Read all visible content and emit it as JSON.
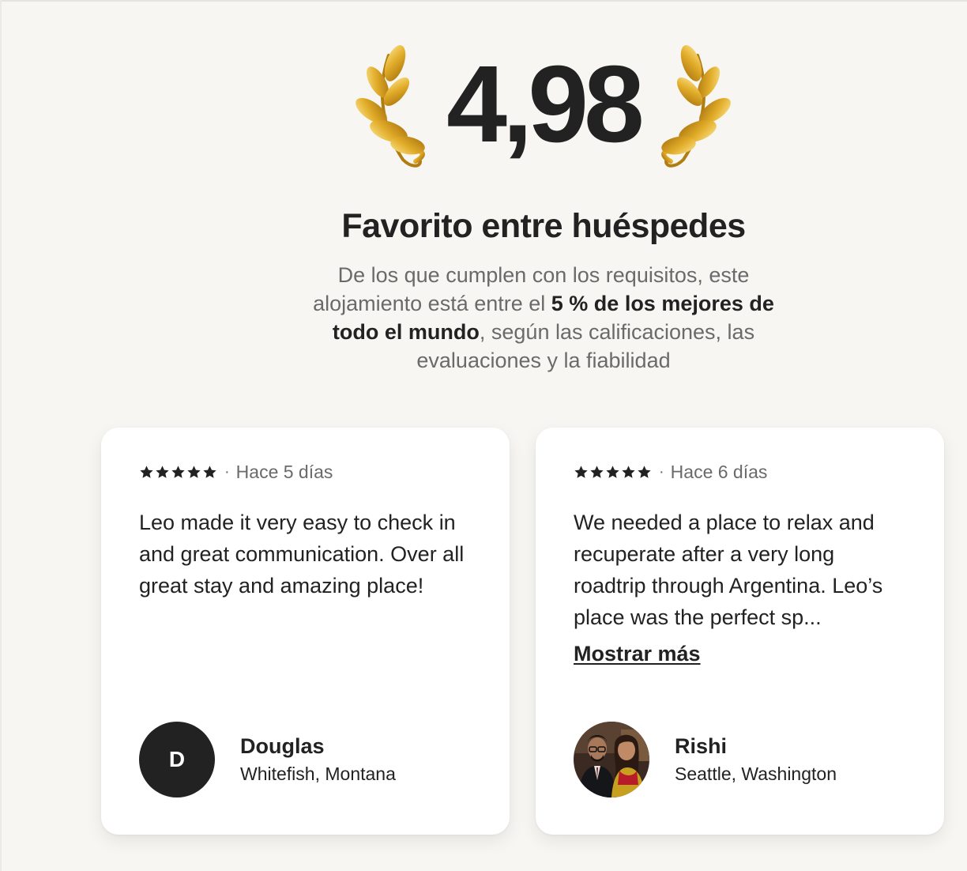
{
  "rating": {
    "value": "4,98",
    "icons": {
      "left": "laurel-left-icon",
      "right": "laurel-right-icon"
    },
    "laurel_color": "#d4a017"
  },
  "badge": {
    "title": "Favorito entre huéspedes",
    "description": {
      "part1": "De los que cumplen con los requisitos, este alojamiento está entre el ",
      "bold": "5 % de los mejores de todo el mundo",
      "part2": ", según las calificaciones, las evaluaciones y la fiabilidad"
    }
  },
  "reviews": [
    {
      "stars": 5,
      "star_icon": "star-icon",
      "separator": "·",
      "date": "Hace 5 días",
      "text": "Leo made it very easy to check in and great communication. Over all great stay and amazing place!",
      "author": {
        "initial": "D",
        "name": "Douglas",
        "location": "Whitefish, Montana"
      }
    },
    {
      "stars": 5,
      "star_icon": "star-icon",
      "separator": "·",
      "date": "Hace 6 días",
      "text": "We needed a place to relax and recuperate after a very long roadtrip through Argentina. Leo’s place was the perfect sp...",
      "show_more": "Mostrar más",
      "author": {
        "name": "Rishi",
        "location": "Seattle, Washington",
        "avatar_icon": "profile-photo"
      }
    }
  ],
  "colors": {
    "background": "#f7f6f2",
    "text_primary": "#222222",
    "text_secondary": "#6a6a6a",
    "card": "#ffffff"
  }
}
